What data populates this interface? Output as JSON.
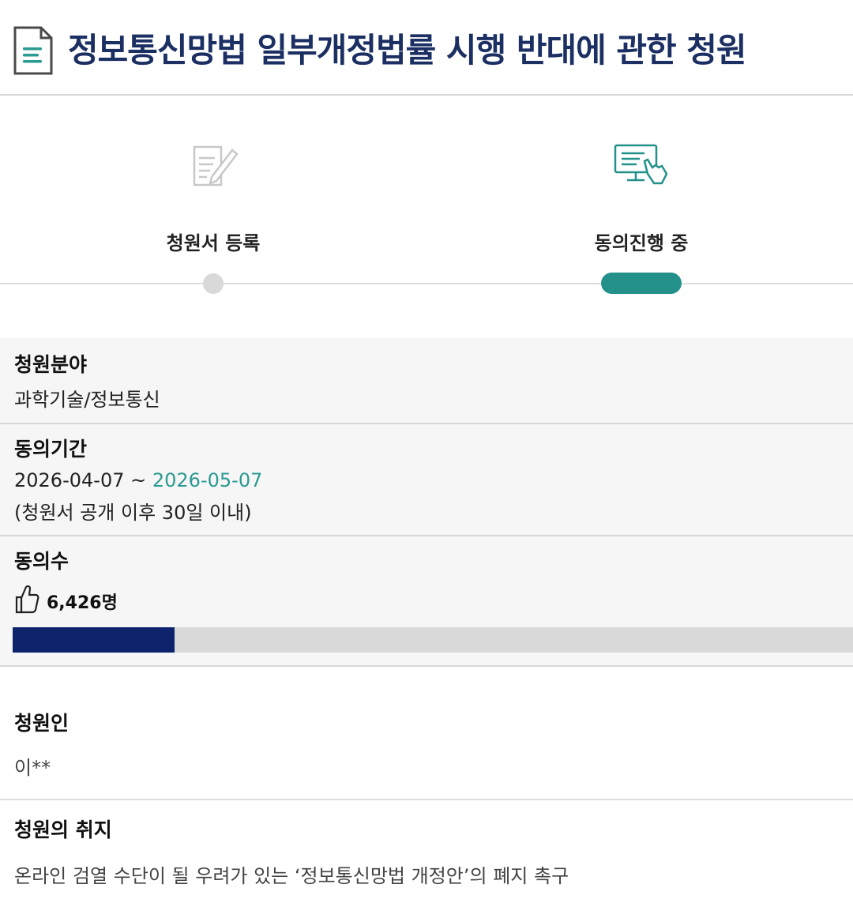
{
  "page": {
    "title": "정보통신망법 일부개정법률 시행 반대에 관한 청원",
    "icons": {
      "title": "document-icon"
    }
  },
  "steps": [
    {
      "label": "청원서 등록",
      "icon": "edit-document-icon",
      "state": "done"
    },
    {
      "label": "동의진행 중",
      "icon": "computer-hand-icon",
      "state": "current"
    }
  ],
  "category": {
    "label": "청원분야",
    "value": "과학기술/정보통신"
  },
  "agree_period": {
    "label": "동의기간",
    "start": "2026-04-07",
    "separator": "~",
    "end": "2026-05-07",
    "note": "(청원서 공개 이후 30일 이내)"
  },
  "agree_count": {
    "label": "동의수",
    "value": "6,426명",
    "icon": "thumbs-up-icon",
    "progress_percent": 19.3
  },
  "petitioner": {
    "label": "청원인",
    "value": "이**"
  },
  "purpose": {
    "label": "청원의 취지",
    "value": "온라인 검열 수단이 될 우려가 있는 ‘정보통신망법 개정안’의 폐지 촉구"
  },
  "colors": {
    "title": "#1b2f63",
    "accent": "#23918a",
    "progress": "#0d246c",
    "track": "#d9d9d9"
  }
}
